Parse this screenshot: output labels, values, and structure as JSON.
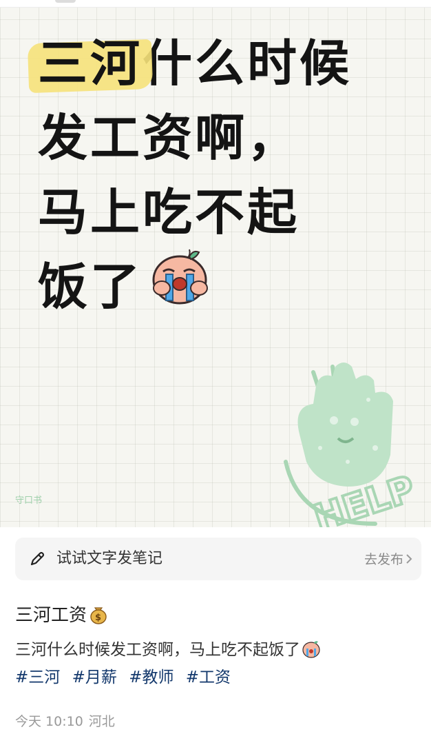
{
  "post_image": {
    "headline_highlight": "三河",
    "headline_line1_rest": "什么时候",
    "headline_line2": "发工资啊，",
    "headline_line3": "马上吃不起",
    "headline_line4": "饭了",
    "highlight_color": "#f6e27a",
    "stamp_text": "HELP",
    "stamp_color": "#a9d6b4",
    "small_mark": "守口书"
  },
  "draft_bar": {
    "hint": "试试文字发笔记",
    "action": "去发布"
  },
  "note": {
    "title": "三河工资",
    "title_emoji": "money-bag-icon",
    "body": "三河什么时候发工资啊，马上吃不起饭了",
    "body_emoji": "crying-face-icon",
    "tags": [
      "#三河",
      "#月薪",
      "#教师",
      "#工资"
    ],
    "tag_color": "#13386c",
    "date": "今天 10:10",
    "location": "河北"
  }
}
